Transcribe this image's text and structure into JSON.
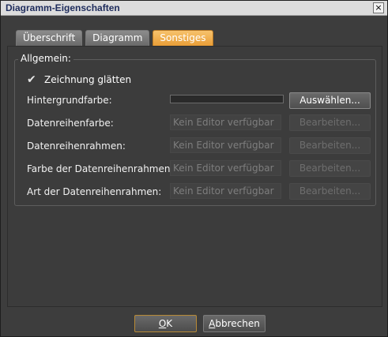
{
  "window": {
    "title": "Diagramm-Eigenschaften",
    "close_glyph": "×"
  },
  "tabs": [
    {
      "label": "Überschrift",
      "active": false
    },
    {
      "label": "Diagramm",
      "active": false
    },
    {
      "label": "Sonstiges",
      "active": true
    }
  ],
  "group": {
    "title": "Allgemein:",
    "checkbox": {
      "label": "Zeichnung glätten",
      "checked": true
    },
    "rows": [
      {
        "label": "Hintergrundfarbe:",
        "editor": "",
        "button": "Auswählen...",
        "enabled": true
      },
      {
        "label": "Datenreihenfarbe:",
        "editor": "Kein Editor verfügbar",
        "button": "Bearbeiten...",
        "enabled": false
      },
      {
        "label": "Datenreihenrahmen:",
        "editor": "Kein Editor verfügbar",
        "button": "Bearbeiten...",
        "enabled": false
      },
      {
        "label": "Farbe der Datenreihenrahmen:",
        "editor": "Kein Editor verfügbar",
        "button": "Bearbeiten...",
        "enabled": false
      },
      {
        "label": "Art der Datenreihenrahmen:",
        "editor": "Kein Editor verfügbar",
        "button": "Bearbeiten...",
        "enabled": false
      }
    ]
  },
  "footer": {
    "ok_mnemonic": "O",
    "ok_rest": "K",
    "cancel_mnemonic": "A",
    "cancel_rest": "bbrechen"
  },
  "colors": {
    "accent_tab": "#e99e37",
    "background": "#3c3c3c",
    "title_text": "#1e2c5c"
  }
}
